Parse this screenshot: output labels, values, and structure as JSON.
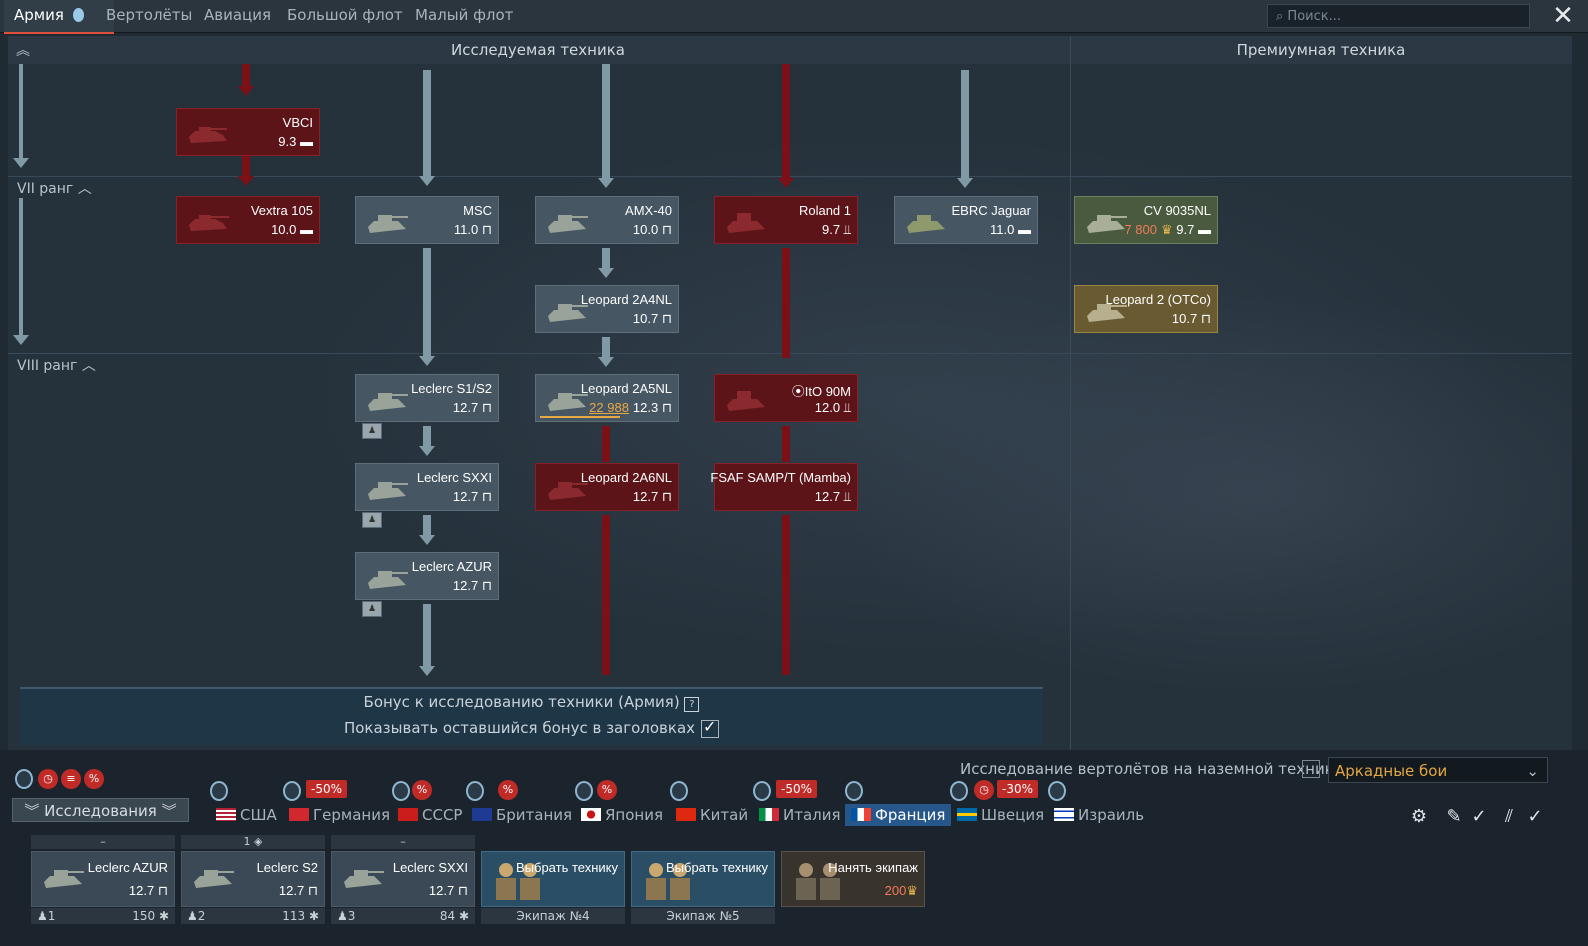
{
  "top_tabs": [
    "Армия",
    "Вертолёты",
    "Авиация",
    "Большой флот",
    "Малый флот"
  ],
  "search_placeholder": "Поиск...",
  "header": {
    "research_title": "Исследуемая техника",
    "premium_title": "Премиумная техника"
  },
  "ranks": {
    "r7": "VII ранг",
    "r8": "VIII ранг"
  },
  "vehicles": {
    "vbci": {
      "name": "VBCI",
      "br": "9.3"
    },
    "vextra": {
      "name": "Vextra 105",
      "br": "10.0"
    },
    "msc": {
      "name": "MSC",
      "br": "11.0"
    },
    "amx40": {
      "name": "AMX-40",
      "br": "10.0"
    },
    "roland": {
      "name": "Roland 1",
      "br": "9.7"
    },
    "ebrc": {
      "name": "EBRC Jaguar",
      "br": "11.0"
    },
    "cv9035": {
      "name": "CV 9035NL",
      "cost": "7 800",
      "br": "9.7"
    },
    "leo2a4": {
      "name": "Leopard 2A4NL",
      "br": "10.7"
    },
    "leo2otco": {
      "name": "Leopard 2 (OTCo)",
      "br": "10.7"
    },
    "leclercs1": {
      "name": "Leclerc S1/S2",
      "br": "12.7"
    },
    "leo2a5": {
      "name": "Leopard 2A5NL",
      "rp": "22 988",
      "br": "12.3"
    },
    "ito90m": {
      "name": "ItO 90M",
      "br": "12.0"
    },
    "leclercsxxi": {
      "name": "Leclerc SXXI",
      "br": "12.7"
    },
    "leo2a6": {
      "name": "Leopard 2A6NL",
      "br": "12.7"
    },
    "fsaf": {
      "name": "FSAF SAMP/T (Mamba)",
      "br": "12.7"
    },
    "leclercazur": {
      "name": "Leclerc AZUR",
      "br": "12.7"
    }
  },
  "bonus": {
    "line1": "Бонус к исследованию техники (Армия)",
    "line2": "Показывать оставшийся бонус в заголовках"
  },
  "research_button": "Исследования",
  "heli_research_label": "Исследование вертолётов на наземной технике",
  "mode_select": "Аркадные бои",
  "nations": [
    {
      "label": "США",
      "discount": ""
    },
    {
      "label": "Германия",
      "discount": "-50%"
    },
    {
      "label": "СССР",
      "discount": ""
    },
    {
      "label": "Британия",
      "discount": ""
    },
    {
      "label": "Япония",
      "discount": ""
    },
    {
      "label": "Китай",
      "discount": ""
    },
    {
      "label": "Италия",
      "discount": "-50%"
    },
    {
      "label": "Франция",
      "discount": ""
    },
    {
      "label": "Швеция",
      "discount": "-30%"
    },
    {
      "label": "Израиль",
      "discount": ""
    }
  ],
  "crew": [
    {
      "head": "–",
      "name": "Leclerc AZUR",
      "br": "12.7",
      "num": "1",
      "val": "150"
    },
    {
      "head": "1",
      "name": "Leclerc S2",
      "br": "12.7",
      "num": "2",
      "val": "113"
    },
    {
      "head": "–",
      "name": "Leclerc SXXI",
      "br": "12.7",
      "num": "3",
      "val": "84"
    }
  ],
  "crew_choose": [
    {
      "label": "Выбрать технику",
      "foot": "Экипаж №4"
    },
    {
      "label": "Выбрать технику",
      "foot": "Экипаж №5"
    }
  ],
  "hire": {
    "label": "Нанять экипаж",
    "cost": "200"
  },
  "colors": {
    "accent_red": "#c02a27",
    "active_nation": "#27578a",
    "gold": "#e4a641"
  }
}
